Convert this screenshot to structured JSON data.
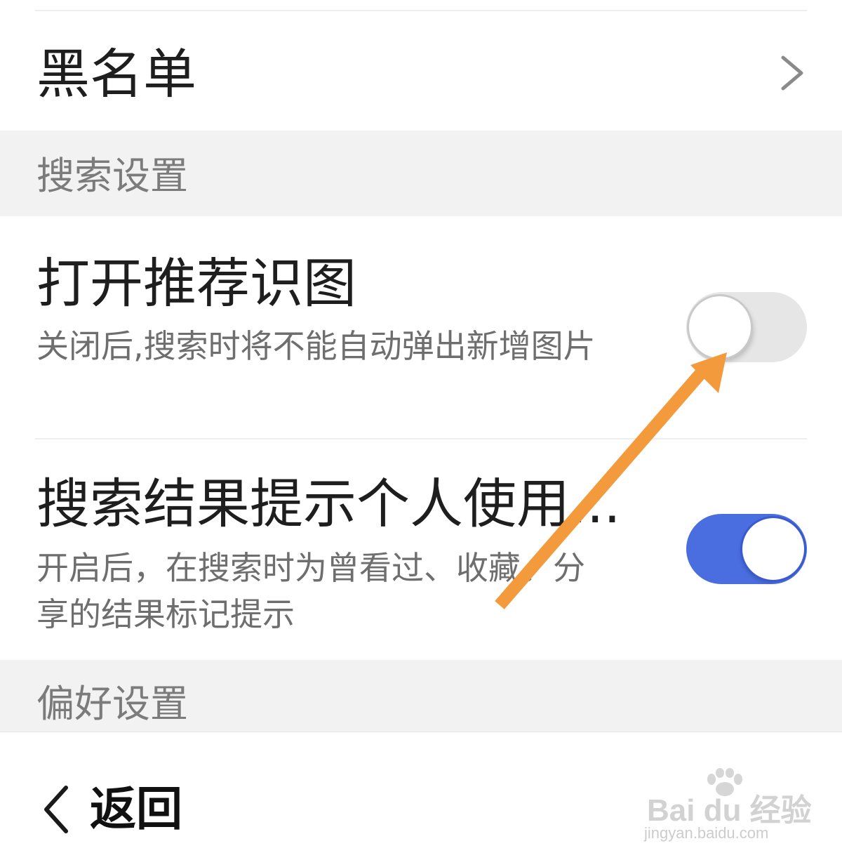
{
  "blacklist_row": {
    "title": "黑名单"
  },
  "sections": {
    "search": "搜索设置",
    "preferences": "偏好设置"
  },
  "settings": [
    {
      "title": "打开推荐识图",
      "description": "关闭后,搜索时将不能自动弹出新增图片",
      "enabled": false
    },
    {
      "title": "搜索结果提示个人使用...",
      "description": "开启后，在搜索时为曾看过、收藏、分享的结果标记提示",
      "enabled": true
    }
  ],
  "footer": {
    "back_label": "返回"
  },
  "watermark": {
    "brand": "Bai du 经验",
    "url": "jingyan.baidu.com"
  },
  "colors": {
    "toggle_on": "#4a6de0",
    "toggle_off": "#e6e6e6",
    "section_background": "#f2f2f2",
    "annotation_arrow": "#f39a3c"
  },
  "annotation": {
    "type": "arrow",
    "points_to": "打开推荐识图 toggle"
  }
}
